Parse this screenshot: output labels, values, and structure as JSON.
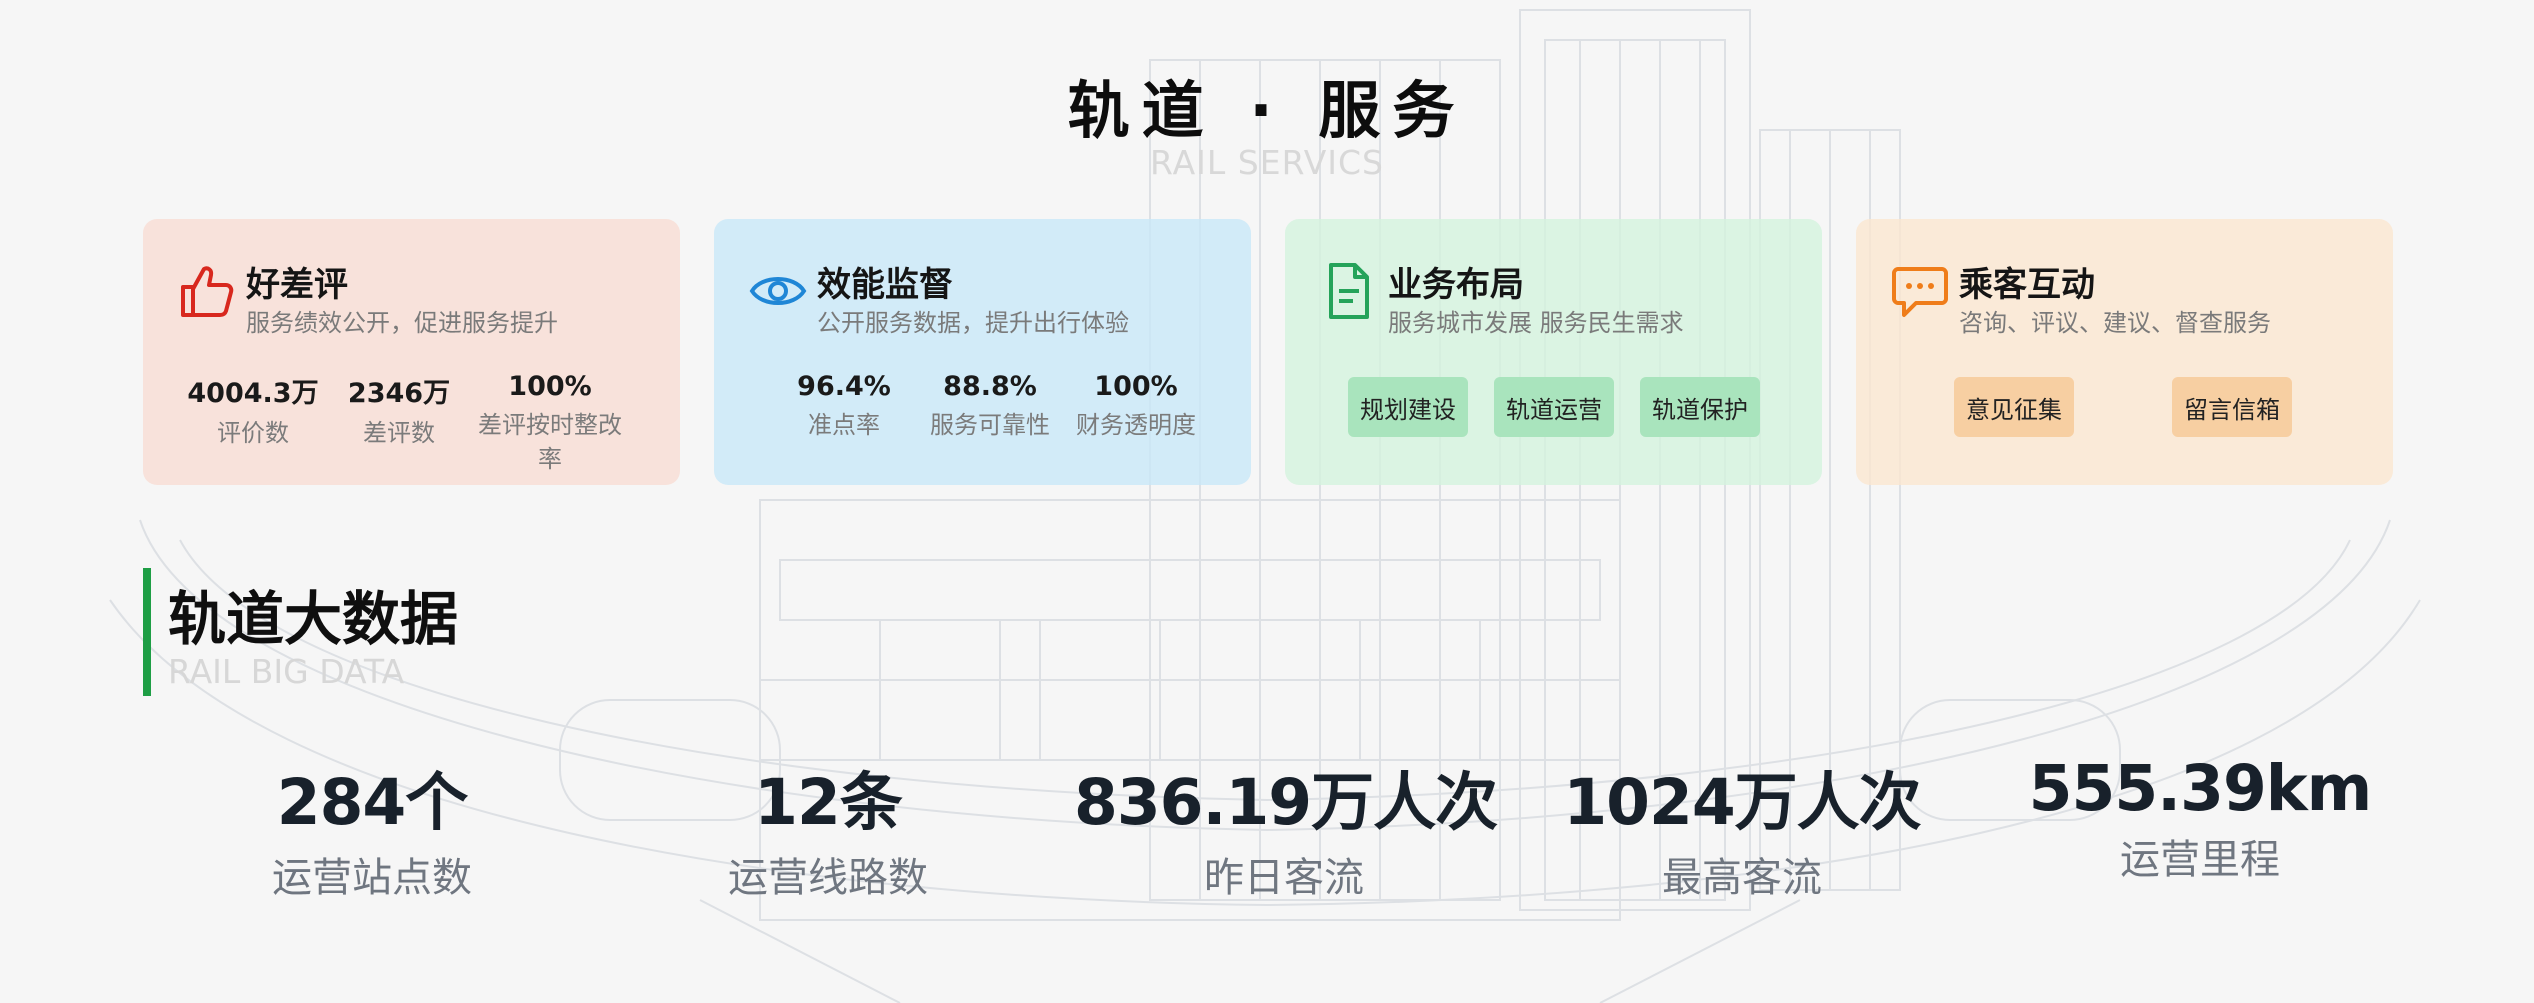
{
  "header": {
    "title": "轨道 · 服务",
    "subtitle": "RAIL SERVICS"
  },
  "cards": [
    {
      "title": "好差评",
      "desc": "服务绩效公开，促进服务提升",
      "icon": "thumbs-up-icon",
      "stats": [
        {
          "value": "4004.3万",
          "label": "评价数"
        },
        {
          "value": "2346万",
          "label": "差评数"
        },
        {
          "value": "100%",
          "label": "差评按时整改率"
        }
      ]
    },
    {
      "title": "效能监督",
      "desc": "公开服务数据，提升出行体验",
      "icon": "eye-icon",
      "stats": [
        {
          "value": "96.4%",
          "label": "准点率"
        },
        {
          "value": "88.8%",
          "label": "服务可靠性"
        },
        {
          "value": "100%",
          "label": "财务透明度"
        }
      ]
    },
    {
      "title": "业务布局",
      "desc": "服务城市发展 服务民生需求",
      "icon": "document-icon",
      "buttons": [
        "规划建设",
        "轨道运营",
        "轨道保护"
      ]
    },
    {
      "title": "乘客互动",
      "desc": "咨询、评议、建议、督查服务",
      "icon": "chat-bubble-icon",
      "buttons": [
        "意见征集",
        "留言信箱"
      ]
    }
  ],
  "section": {
    "title": "轨道大数据",
    "subtitle": "RAIL BIG DATA"
  },
  "metrics": [
    {
      "value": "284个",
      "label": "运营站点数"
    },
    {
      "value": "12条",
      "label": "运营线路数"
    },
    {
      "value": "836.19万人次",
      "label": "昨日客流"
    },
    {
      "value": "1024万人次",
      "label": "最高客流"
    },
    {
      "value": "555.39km",
      "label": "运营里程"
    }
  ],
  "colors": {
    "accent_green": "#1e9e45",
    "icon_red": "#d8281e",
    "icon_blue": "#1f86d6",
    "icon_green": "#25a35a",
    "icon_orange": "#ef7d1a"
  }
}
